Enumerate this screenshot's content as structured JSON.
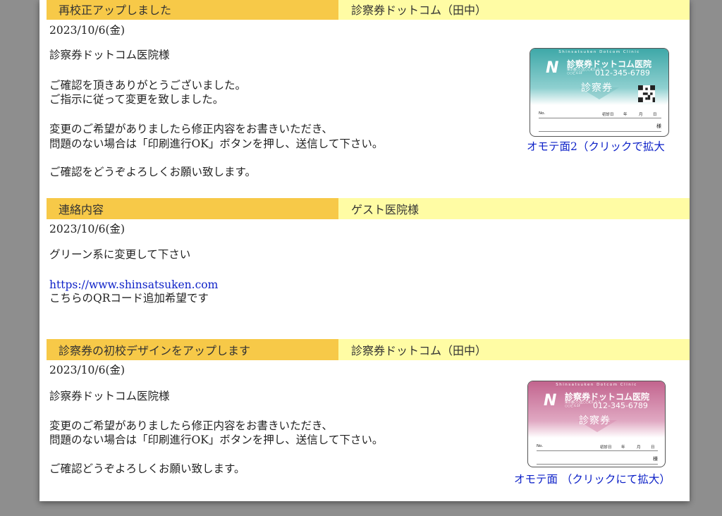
{
  "messages": [
    {
      "subject": "再校正アップしました",
      "sender": "診察券ドットコム（田中）",
      "date": "2023/10/6(金)",
      "lines": [
        "診察券ドットコム医院様",
        "ご確認を頂きありがとうございました。",
        "ご指示に従って変更を致しました。",
        "変更のご希望がありましたら修正内容をお書きいただき、",
        "問題のない場合は「印刷進行OK」ボタンを押し、送信して下さい。",
        "ご確認をどうぞよろしくお願い致します。"
      ],
      "caption": "オモテ面2（クリックで拡大"
    },
    {
      "subject": "連絡内容",
      "sender": "ゲスト医院様",
      "date": "2023/10/6(金)",
      "lines": [
        "グリーン系に変更して下さい"
      ],
      "link": "https://www.shinsatsuken.com",
      "after_link": "こちらのQRコード追加希望です"
    },
    {
      "subject": "診察券の初校デザインをアップします",
      "sender": "診察券ドットコム（田中）",
      "date": "2023/10/6(金)",
      "lines": [
        "診察券ドットコム医院様",
        "変更のご希望がありましたら修正内容をお書きいただき、",
        "問題のない場合は「印刷進行OK」ボタンを押し、送信して下さい。",
        "ご確認どうぞよろしくお願い致します。"
      ],
      "caption": "オモテ面 （クリックにて拡大）"
    }
  ],
  "card": {
    "tagline": "Shinsatsuken Dotcom Clinic",
    "logo": "N",
    "clinic_name": "診察券ドットコム医院",
    "address": "東京都○○区○○町1-2-3\n○○ビル1F",
    "phone": "012-345-6789",
    "kind": "診察券",
    "no_label": "No.",
    "first_visit": "初診日",
    "year": "年",
    "month": "月",
    "day": "日",
    "honorific": "様"
  },
  "colors": {
    "subject_bg": "#f7c948",
    "sender_bg": "#fffca4",
    "link": "#0e22c8",
    "card_teal": "#57b8b8",
    "card_pink": "#c9739a"
  }
}
